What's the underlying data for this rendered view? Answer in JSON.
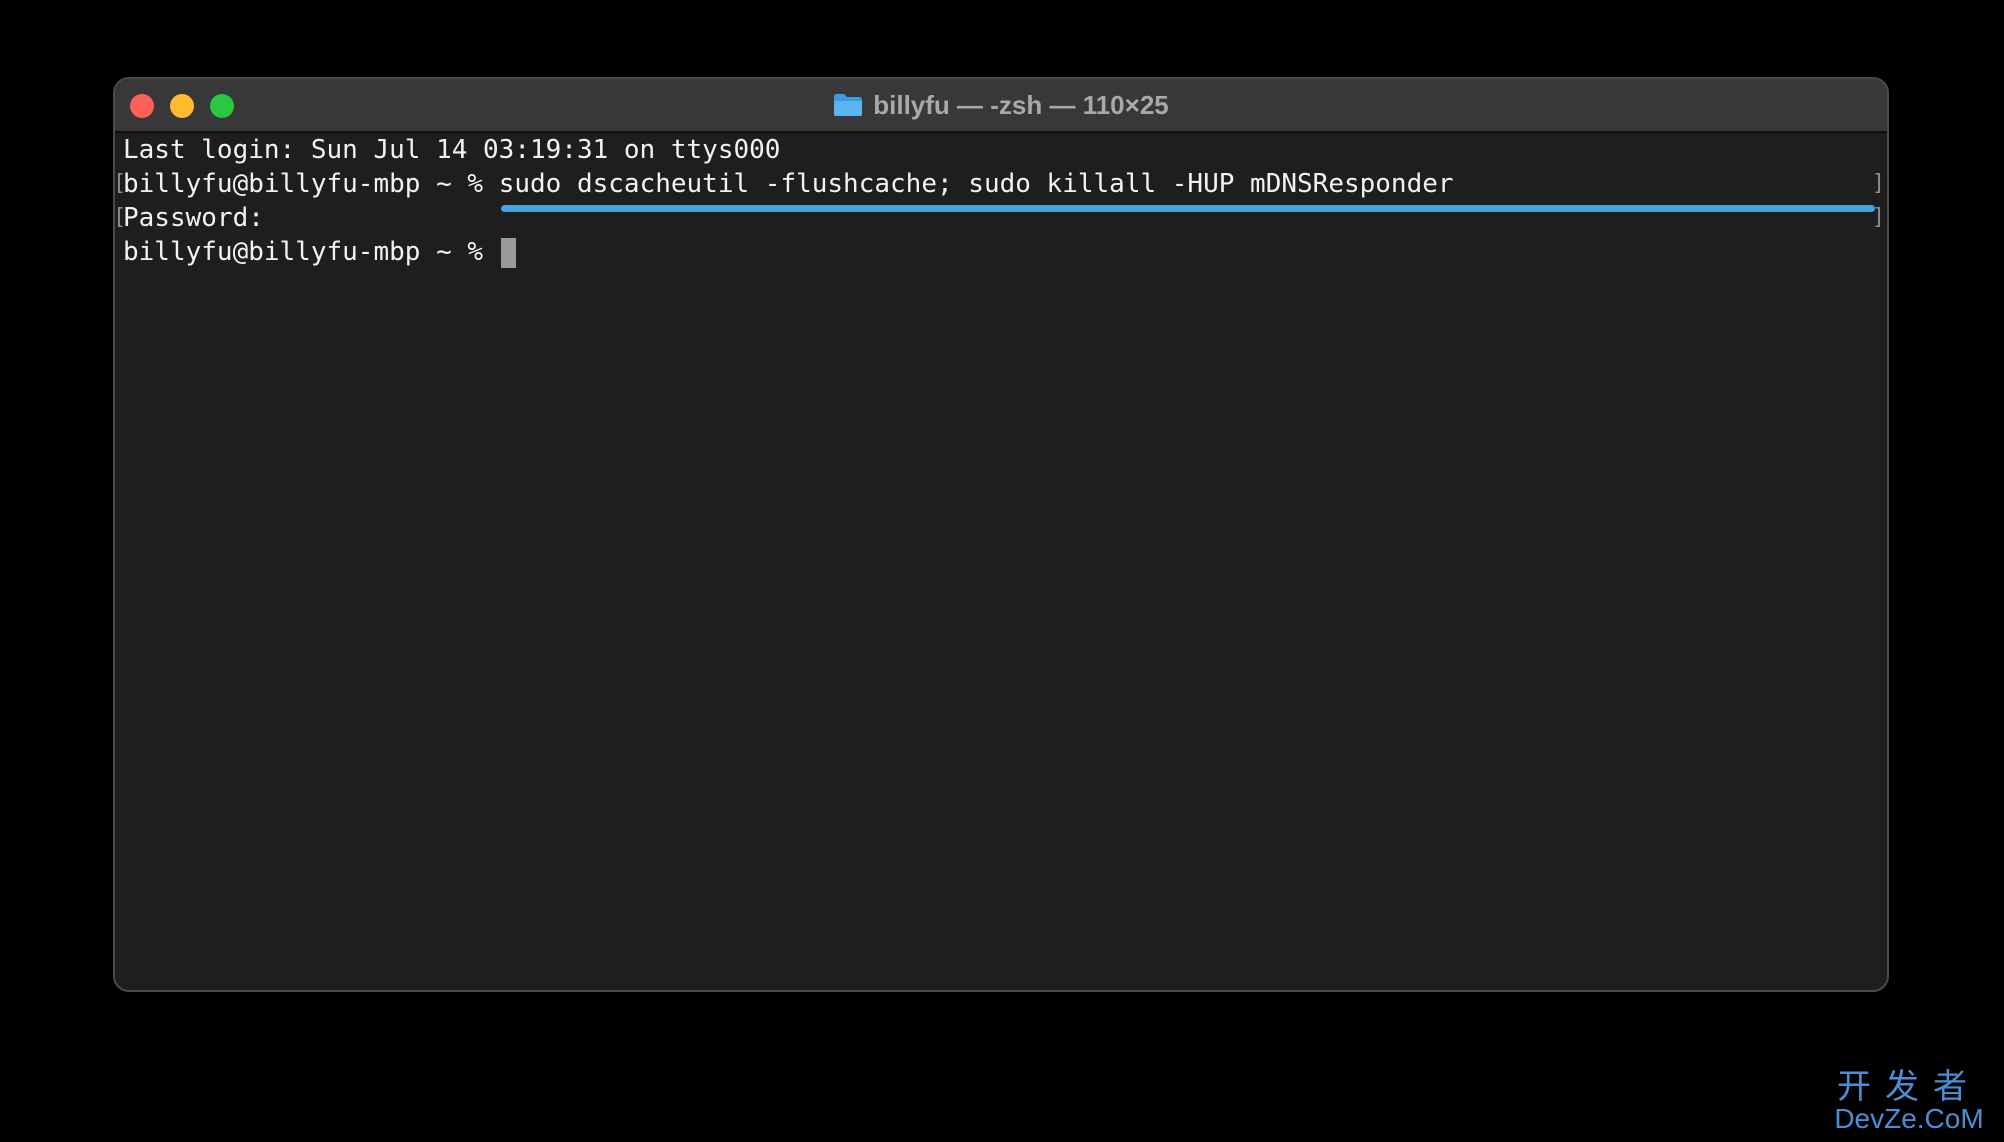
{
  "window": {
    "title": "billyfu — -zsh — 110×25",
    "title_icon": "folder-icon"
  },
  "terminal": {
    "line1": "Last login: Sun Jul 14 03:19:31 on ttys000",
    "line2_prompt": "billyfu@billyfu-mbp ~ % ",
    "line2_command": "sudo dscacheutil -flushcache; sudo killall -HUP mDNSResponder",
    "line3": "Password:",
    "line4_prompt": "billyfu@billyfu-mbp ~ % ",
    "highlight_color": "#4aa3df"
  },
  "watermark": {
    "top": "开发者",
    "bottom": "DevZe.CoM"
  }
}
